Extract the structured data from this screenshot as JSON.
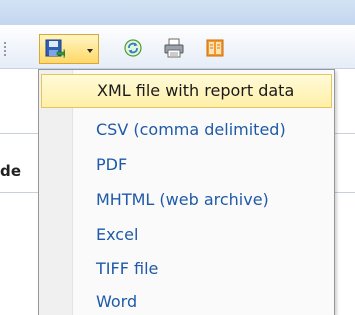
{
  "toolbar": {
    "export_button": {
      "icon": "save-icon",
      "menu_open": true
    },
    "refresh_icon": "refresh-icon",
    "print_icon": "print-icon",
    "layout_icon": "print-layout-icon"
  },
  "report": {
    "partial_column_text": "de"
  },
  "export_menu": {
    "items": [
      {
        "label": "XML file with report data",
        "highlighted": true
      },
      {
        "label": "CSV (comma delimited)",
        "highlighted": false
      },
      {
        "label": "PDF",
        "highlighted": false
      },
      {
        "label": "MHTML (web archive)",
        "highlighted": false
      },
      {
        "label": "Excel",
        "highlighted": false
      },
      {
        "label": "TIFF file",
        "highlighted": false
      },
      {
        "label": "Word",
        "highlighted": false
      }
    ]
  },
  "colors": {
    "menu_text": "#1f5aa8",
    "highlight": "#fff0a8",
    "toolbar_top": "#c4d6ee"
  }
}
